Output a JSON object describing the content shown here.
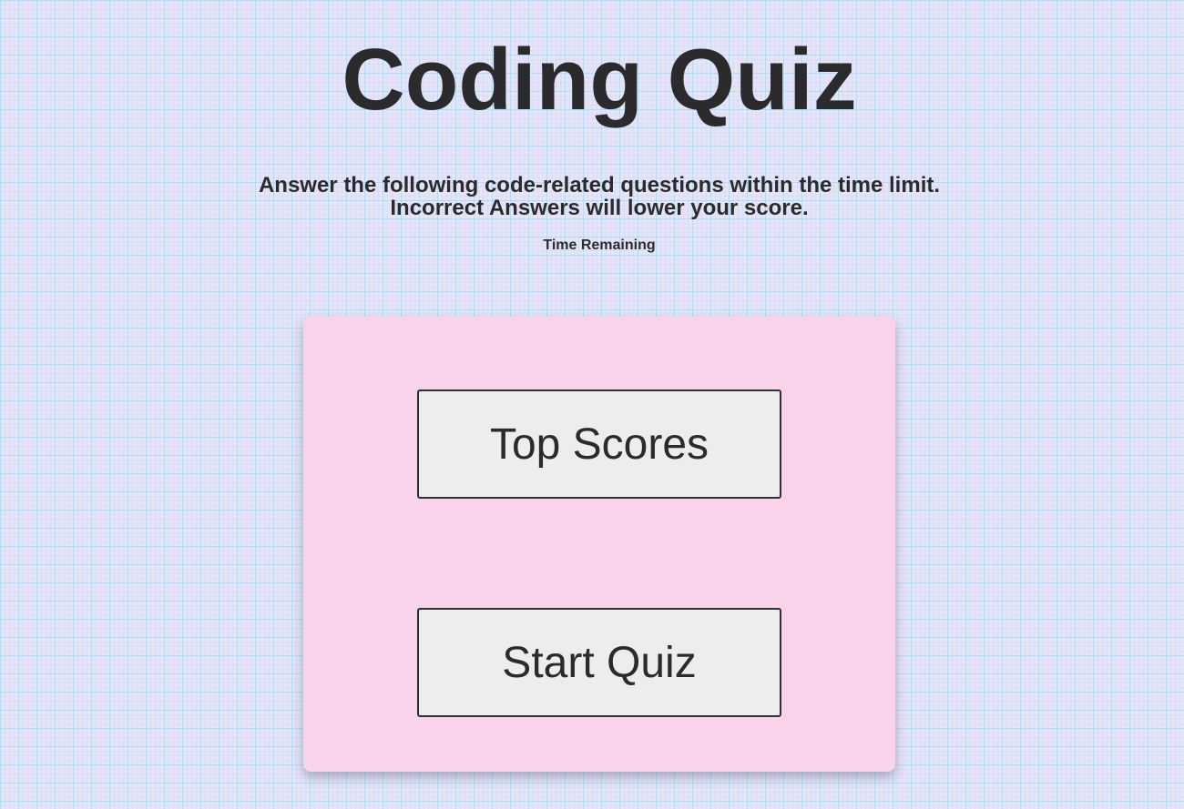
{
  "header": {
    "title": "Coding Quiz",
    "instructions_line1": "Answer the following code-related questions within the time limit.",
    "instructions_line2": "Incorrect Answers will lower your score.",
    "timer_label": "Time Remaining"
  },
  "menu": {
    "top_scores_label": "Top Scores",
    "start_quiz_label": "Start Quiz"
  },
  "colors": {
    "background": "#e2e6f8",
    "card": "#f9d2ec",
    "button": "#ededf0",
    "text": "#2b2b2e"
  }
}
